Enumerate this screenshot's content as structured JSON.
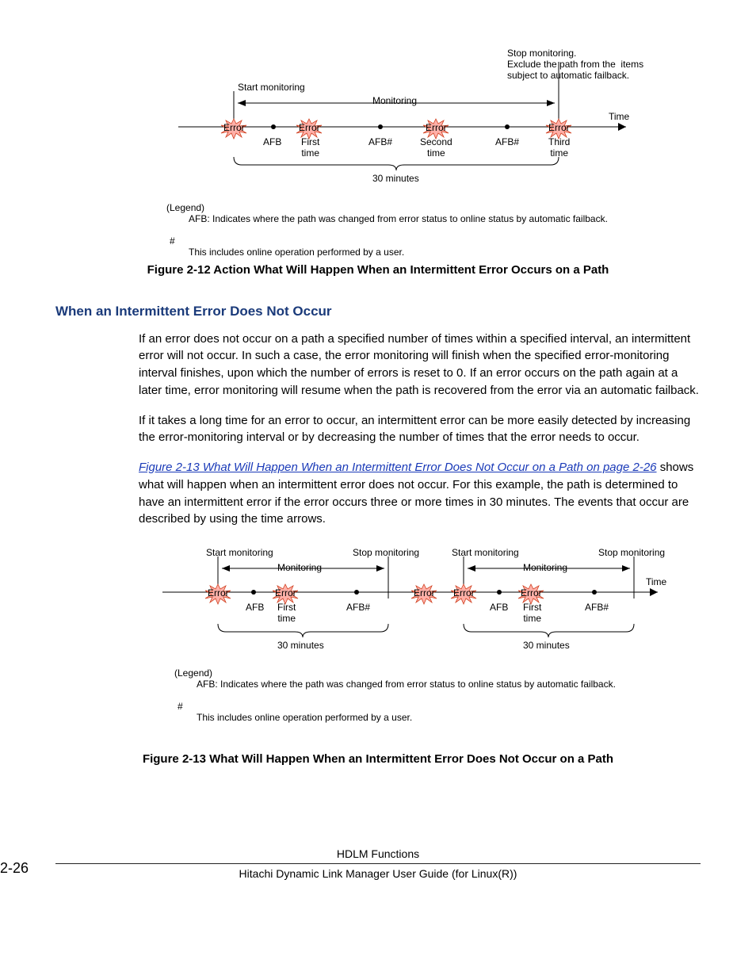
{
  "diagram1": {
    "start_monitoring": "Start monitoring",
    "monitoring": "Monitoring",
    "stop_text": "Stop monitoring.\nExclude the path from the  items\nsubject to automatic failback.",
    "time": "Time",
    "error": "Error",
    "afb": "AFB",
    "afb_hash": "AFB#",
    "first_time": "First\ntime",
    "second_time": "Second\ntime",
    "third_time": "Third\ntime",
    "thirty_min": "30 minutes",
    "legend_title": "(Legend)",
    "legend_afb": "AFB: Indicates where the path was changed from error status to online status by automatic failback.",
    "hash": "#",
    "hash_note": "This includes online operation performed by a user."
  },
  "caption1": "Figure 2-12 Action What Will Happen When an Intermittent Error Occurs on a Path",
  "section_heading": "When an Intermittent Error Does Not Occur",
  "para1": "If an error does not occur on a path a specified number of times within a specified interval, an intermittent error will not occur. In such a case, the error monitoring will finish when the specified error-monitoring interval finishes, upon which the number of errors is reset to 0. If an error occurs on the path again at a later time, error monitoring will resume when the path is recovered from the error via an automatic failback.",
  "para2": "If it takes a long time for an error to occur, an intermittent error can be more easily detected by increasing the error-monitoring interval or by decreasing the number of times that the error needs to occur.",
  "xref_text": "Figure 2-13 What Will Happen When an Intermittent Error Does Not Occur on a Path on page 2-26",
  "para3_after": " shows what will happen when an intermittent error does not occur. For this example, the path is determined to have an intermittent error if the error occurs three or more times in 30 minutes. The events that occur are described by using the time arrows.",
  "diagram2": {
    "start_monitoring": "Start monitoring",
    "stop_monitoring": "Stop monitoring",
    "monitoring": "Monitoring",
    "time": "Time",
    "error": "Error",
    "afb": "AFB",
    "afb_hash": "AFB#",
    "first_time": "First\ntime",
    "thirty_min": "30 minutes",
    "legend_title": "(Legend)",
    "legend_afb": "AFB: Indicates where the path was changed from error status to online status by automatic failback.",
    "hash": "#",
    "hash_note": "This includes online operation performed by a user."
  },
  "caption2": "Figure 2-13 What Will Happen When an Intermittent Error Does Not Occur on a Path",
  "footer": {
    "page_number": "2-26",
    "section": "HDLM Functions",
    "doc_title": "Hitachi Dynamic Link Manager User Guide (for Linux(R))"
  }
}
